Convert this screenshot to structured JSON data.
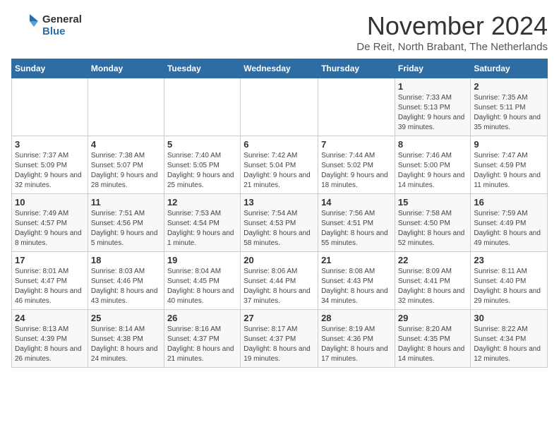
{
  "logo": {
    "line1": "General",
    "line2": "Blue"
  },
  "title": "November 2024",
  "location": "De Reit, North Brabant, The Netherlands",
  "headers": [
    "Sunday",
    "Monday",
    "Tuesday",
    "Wednesday",
    "Thursday",
    "Friday",
    "Saturday"
  ],
  "weeks": [
    [
      {
        "day": "",
        "info": ""
      },
      {
        "day": "",
        "info": ""
      },
      {
        "day": "",
        "info": ""
      },
      {
        "day": "",
        "info": ""
      },
      {
        "day": "",
        "info": ""
      },
      {
        "day": "1",
        "info": "Sunrise: 7:33 AM\nSunset: 5:13 PM\nDaylight: 9 hours and 39 minutes."
      },
      {
        "day": "2",
        "info": "Sunrise: 7:35 AM\nSunset: 5:11 PM\nDaylight: 9 hours and 35 minutes."
      }
    ],
    [
      {
        "day": "3",
        "info": "Sunrise: 7:37 AM\nSunset: 5:09 PM\nDaylight: 9 hours and 32 minutes."
      },
      {
        "day": "4",
        "info": "Sunrise: 7:38 AM\nSunset: 5:07 PM\nDaylight: 9 hours and 28 minutes."
      },
      {
        "day": "5",
        "info": "Sunrise: 7:40 AM\nSunset: 5:05 PM\nDaylight: 9 hours and 25 minutes."
      },
      {
        "day": "6",
        "info": "Sunrise: 7:42 AM\nSunset: 5:04 PM\nDaylight: 9 hours and 21 minutes."
      },
      {
        "day": "7",
        "info": "Sunrise: 7:44 AM\nSunset: 5:02 PM\nDaylight: 9 hours and 18 minutes."
      },
      {
        "day": "8",
        "info": "Sunrise: 7:46 AM\nSunset: 5:00 PM\nDaylight: 9 hours and 14 minutes."
      },
      {
        "day": "9",
        "info": "Sunrise: 7:47 AM\nSunset: 4:59 PM\nDaylight: 9 hours and 11 minutes."
      }
    ],
    [
      {
        "day": "10",
        "info": "Sunrise: 7:49 AM\nSunset: 4:57 PM\nDaylight: 9 hours and 8 minutes."
      },
      {
        "day": "11",
        "info": "Sunrise: 7:51 AM\nSunset: 4:56 PM\nDaylight: 9 hours and 5 minutes."
      },
      {
        "day": "12",
        "info": "Sunrise: 7:53 AM\nSunset: 4:54 PM\nDaylight: 9 hours and 1 minute."
      },
      {
        "day": "13",
        "info": "Sunrise: 7:54 AM\nSunset: 4:53 PM\nDaylight: 8 hours and 58 minutes."
      },
      {
        "day": "14",
        "info": "Sunrise: 7:56 AM\nSunset: 4:51 PM\nDaylight: 8 hours and 55 minutes."
      },
      {
        "day": "15",
        "info": "Sunrise: 7:58 AM\nSunset: 4:50 PM\nDaylight: 8 hours and 52 minutes."
      },
      {
        "day": "16",
        "info": "Sunrise: 7:59 AM\nSunset: 4:49 PM\nDaylight: 8 hours and 49 minutes."
      }
    ],
    [
      {
        "day": "17",
        "info": "Sunrise: 8:01 AM\nSunset: 4:47 PM\nDaylight: 8 hours and 46 minutes."
      },
      {
        "day": "18",
        "info": "Sunrise: 8:03 AM\nSunset: 4:46 PM\nDaylight: 8 hours and 43 minutes."
      },
      {
        "day": "19",
        "info": "Sunrise: 8:04 AM\nSunset: 4:45 PM\nDaylight: 8 hours and 40 minutes."
      },
      {
        "day": "20",
        "info": "Sunrise: 8:06 AM\nSunset: 4:44 PM\nDaylight: 8 hours and 37 minutes."
      },
      {
        "day": "21",
        "info": "Sunrise: 8:08 AM\nSunset: 4:43 PM\nDaylight: 8 hours and 34 minutes."
      },
      {
        "day": "22",
        "info": "Sunrise: 8:09 AM\nSunset: 4:41 PM\nDaylight: 8 hours and 32 minutes."
      },
      {
        "day": "23",
        "info": "Sunrise: 8:11 AM\nSunset: 4:40 PM\nDaylight: 8 hours and 29 minutes."
      }
    ],
    [
      {
        "day": "24",
        "info": "Sunrise: 8:13 AM\nSunset: 4:39 PM\nDaylight: 8 hours and 26 minutes."
      },
      {
        "day": "25",
        "info": "Sunrise: 8:14 AM\nSunset: 4:38 PM\nDaylight: 8 hours and 24 minutes."
      },
      {
        "day": "26",
        "info": "Sunrise: 8:16 AM\nSunset: 4:37 PM\nDaylight: 8 hours and 21 minutes."
      },
      {
        "day": "27",
        "info": "Sunrise: 8:17 AM\nSunset: 4:37 PM\nDaylight: 8 hours and 19 minutes."
      },
      {
        "day": "28",
        "info": "Sunrise: 8:19 AM\nSunset: 4:36 PM\nDaylight: 8 hours and 17 minutes."
      },
      {
        "day": "29",
        "info": "Sunrise: 8:20 AM\nSunset: 4:35 PM\nDaylight: 8 hours and 14 minutes."
      },
      {
        "day": "30",
        "info": "Sunrise: 8:22 AM\nSunset: 4:34 PM\nDaylight: 8 hours and 12 minutes."
      }
    ]
  ]
}
